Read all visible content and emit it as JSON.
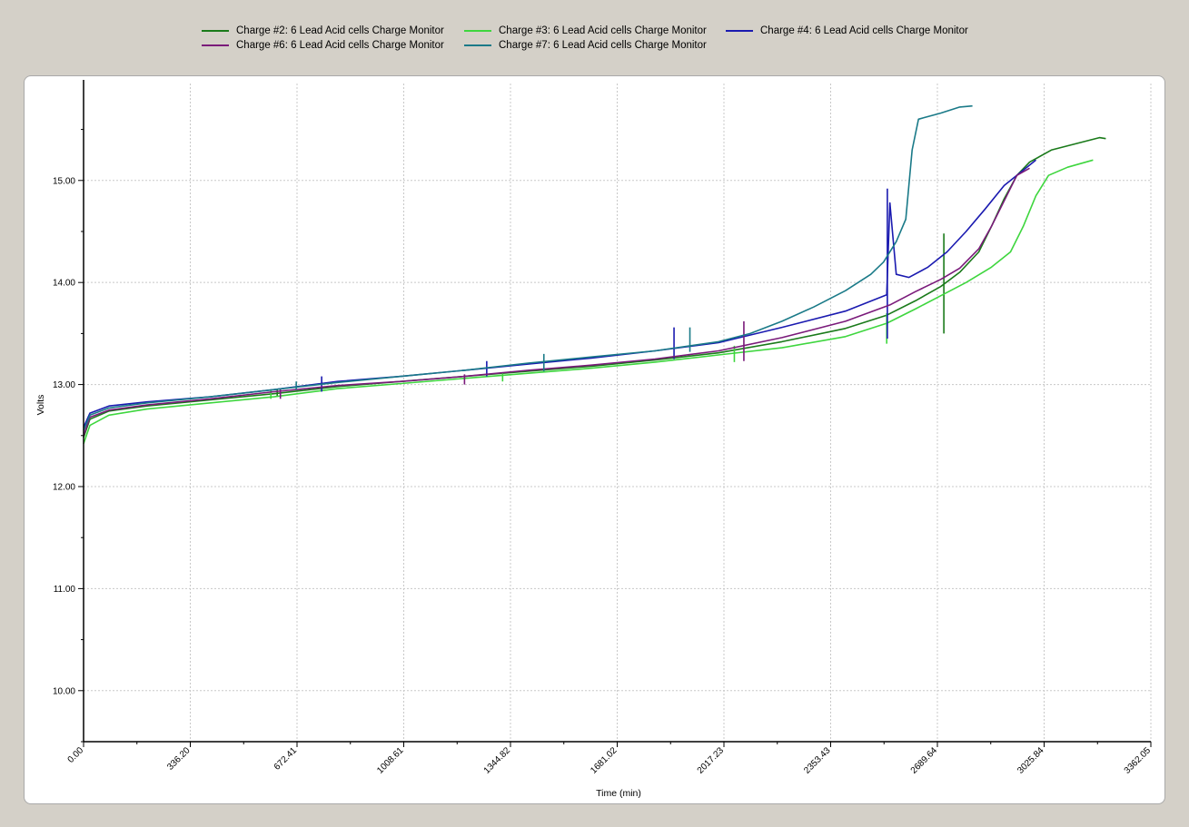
{
  "chart_data": {
    "type": "line",
    "xlabel": "Time (min)",
    "ylabel": "Volts",
    "xlim": [
      0,
      3362.05
    ],
    "ylim": [
      9.5,
      15.95
    ],
    "x_ticks": [
      "0.00",
      "336.20",
      "672.41",
      "1008.61",
      "1344.82",
      "1681.02",
      "2017.23",
      "2353.43",
      "2689.64",
      "3025.84",
      "3362.05"
    ],
    "x_tick_values": [
      0,
      336.2,
      672.41,
      1008.61,
      1344.82,
      1681.02,
      2017.23,
      2353.43,
      2689.64,
      3025.84,
      3362.05
    ],
    "y_ticks": [
      "10.00",
      "11.00",
      "12.00",
      "13.00",
      "14.00",
      "15.00"
    ],
    "y_tick_values": [
      10,
      11,
      12,
      13,
      14,
      15
    ],
    "grid": true,
    "legend_position": "top",
    "series": [
      {
        "name": "Charge #2: 6 Lead Acid cells Charge Monitor",
        "color": "#1a7a1a",
        "points": [
          [
            0,
            12.48
          ],
          [
            20,
            12.66
          ],
          [
            80,
            12.74
          ],
          [
            200,
            12.79
          ],
          [
            400,
            12.85
          ],
          [
            600,
            12.91
          ],
          [
            800,
            12.98
          ],
          [
            1000,
            13.03
          ],
          [
            1200,
            13.08
          ],
          [
            1400,
            13.13
          ],
          [
            1600,
            13.18
          ],
          [
            1800,
            13.24
          ],
          [
            2000,
            13.31
          ],
          [
            2200,
            13.42
          ],
          [
            2400,
            13.55
          ],
          [
            2530,
            13.68
          ],
          [
            2620,
            13.82
          ],
          [
            2700,
            13.96
          ],
          [
            2760,
            14.1
          ],
          [
            2820,
            14.3
          ],
          [
            2860,
            14.55
          ],
          [
            2900,
            14.82
          ],
          [
            2940,
            15.05
          ],
          [
            2980,
            15.18
          ],
          [
            3050,
            15.3
          ],
          [
            3150,
            15.38
          ],
          [
            3200,
            15.42
          ],
          [
            3220,
            15.41
          ]
        ],
        "spikes": [
          [
            610,
            12.88,
            12.96
          ],
          [
            2710,
            13.5,
            14.48
          ]
        ]
      },
      {
        "name": "Charge #3: 6 Lead Acid cells Charge Monitor",
        "color": "#3ed63e",
        "points": [
          [
            0,
            12.42
          ],
          [
            20,
            12.6
          ],
          [
            80,
            12.7
          ],
          [
            200,
            12.76
          ],
          [
            400,
            12.82
          ],
          [
            600,
            12.88
          ],
          [
            800,
            12.96
          ],
          [
            1000,
            13.01
          ],
          [
            1200,
            13.06
          ],
          [
            1400,
            13.11
          ],
          [
            1600,
            13.16
          ],
          [
            1800,
            13.22
          ],
          [
            2000,
            13.29
          ],
          [
            2200,
            13.36
          ],
          [
            2400,
            13.47
          ],
          [
            2530,
            13.6
          ],
          [
            2620,
            13.74
          ],
          [
            2700,
            13.87
          ],
          [
            2780,
            14.0
          ],
          [
            2860,
            14.15
          ],
          [
            2920,
            14.3
          ],
          [
            2960,
            14.55
          ],
          [
            3000,
            14.85
          ],
          [
            3040,
            15.05
          ],
          [
            3100,
            15.13
          ],
          [
            3180,
            15.2
          ]
        ],
        "spikes": [
          [
            590,
            12.86,
            12.94
          ],
          [
            1320,
            13.03,
            13.12
          ],
          [
            2050,
            13.22,
            13.38
          ],
          [
            2530,
            13.4,
            13.7
          ]
        ]
      },
      {
        "name": "Charge #4: 6 Lead Acid cells Charge Monitor",
        "color": "#1a1ab0",
        "points": [
          [
            0,
            12.58
          ],
          [
            20,
            12.72
          ],
          [
            80,
            12.79
          ],
          [
            200,
            12.83
          ],
          [
            400,
            12.88
          ],
          [
            600,
            12.95
          ],
          [
            800,
            13.03
          ],
          [
            1000,
            13.08
          ],
          [
            1200,
            13.14
          ],
          [
            1400,
            13.2
          ],
          [
            1600,
            13.26
          ],
          [
            1800,
            13.33
          ],
          [
            2000,
            13.41
          ],
          [
            2200,
            13.56
          ],
          [
            2400,
            13.72
          ],
          [
            2530,
            13.88
          ],
          [
            2540,
            14.78
          ],
          [
            2560,
            14.08
          ],
          [
            2600,
            14.05
          ],
          [
            2660,
            14.15
          ],
          [
            2720,
            14.3
          ],
          [
            2780,
            14.5
          ],
          [
            2840,
            14.72
          ],
          [
            2900,
            14.95
          ],
          [
            2960,
            15.1
          ],
          [
            3000,
            15.2
          ]
        ],
        "spikes": [
          [
            750,
            12.93,
            13.08
          ],
          [
            1270,
            13.08,
            13.23
          ],
          [
            1860,
            13.25,
            13.56
          ],
          [
            2532,
            13.45,
            14.92
          ]
        ]
      },
      {
        "name": "Charge #6: 6 Lead Acid cells Charge Monitor",
        "color": "#7a1a7a",
        "points": [
          [
            0,
            12.5
          ],
          [
            20,
            12.68
          ],
          [
            80,
            12.75
          ],
          [
            200,
            12.8
          ],
          [
            400,
            12.86
          ],
          [
            600,
            12.93
          ],
          [
            800,
            12.99
          ],
          [
            1000,
            13.03
          ],
          [
            1200,
            13.08
          ],
          [
            1400,
            13.14
          ],
          [
            1600,
            13.19
          ],
          [
            1800,
            13.25
          ],
          [
            2000,
            13.33
          ],
          [
            2200,
            13.46
          ],
          [
            2400,
            13.62
          ],
          [
            2540,
            13.78
          ],
          [
            2620,
            13.91
          ],
          [
            2700,
            14.03
          ],
          [
            2760,
            14.14
          ],
          [
            2820,
            14.33
          ],
          [
            2860,
            14.55
          ],
          [
            2900,
            14.8
          ],
          [
            2940,
            15.05
          ],
          [
            2980,
            15.12
          ]
        ],
        "spikes": [
          [
            620,
            12.86,
            12.96
          ],
          [
            1200,
            13.0,
            13.1
          ],
          [
            2080,
            13.23,
            13.62
          ]
        ]
      },
      {
        "name": "Charge #7: 6 Lead Acid cells Charge Monitor",
        "color": "#1a7a88",
        "points": [
          [
            0,
            12.55
          ],
          [
            20,
            12.7
          ],
          [
            80,
            12.77
          ],
          [
            200,
            12.82
          ],
          [
            400,
            12.88
          ],
          [
            600,
            12.95
          ],
          [
            800,
            13.02
          ],
          [
            1000,
            13.08
          ],
          [
            1200,
            13.14
          ],
          [
            1400,
            13.21
          ],
          [
            1600,
            13.27
          ],
          [
            1800,
            13.33
          ],
          [
            2000,
            13.42
          ],
          [
            2100,
            13.5
          ],
          [
            2200,
            13.62
          ],
          [
            2300,
            13.76
          ],
          [
            2400,
            13.92
          ],
          [
            2480,
            14.08
          ],
          [
            2520,
            14.2
          ],
          [
            2560,
            14.4
          ],
          [
            2590,
            14.62
          ],
          [
            2610,
            15.3
          ],
          [
            2630,
            15.6
          ],
          [
            2700,
            15.66
          ],
          [
            2760,
            15.72
          ],
          [
            2800,
            15.73
          ]
        ],
        "spikes": [
          [
            670,
            12.95,
            13.03
          ],
          [
            1450,
            13.13,
            13.3
          ],
          [
            1910,
            13.32,
            13.56
          ]
        ]
      }
    ]
  }
}
